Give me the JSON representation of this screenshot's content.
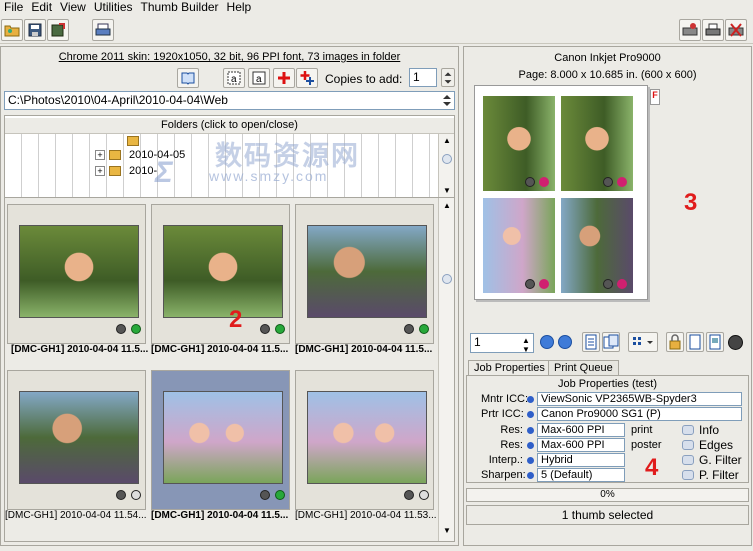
{
  "menu": [
    "File",
    "Edit",
    "View",
    "Utilities",
    "Thumb Builder",
    "Help"
  ],
  "left": {
    "info_line": "Chrome 2011 skin: 1920x1050, 32 bit, 96 PPI font, 73 images in folder",
    "copies_label": "Copies to add:",
    "copies_value": "1",
    "path": "C:\\Photos\\2010\\04-April\\2010-04-04\\Web",
    "folders_header": "Folders (click to open/close)",
    "folders": [
      "2010-04-05",
      "2010-"
    ],
    "thumbs": [
      {
        "caption": "[DMC-GH1] 2010-04-04 11.5...",
        "selected": false
      },
      {
        "caption": "[DMC-GH1] 2010-04-04 11.5...",
        "selected": false
      },
      {
        "caption": "[DMC-GH1] 2010-04-04 11.5...",
        "selected": false
      },
      {
        "caption": "[DMC-GH1] 2010-04-04 11.54...",
        "selected": false
      },
      {
        "caption": "[DMC-GH1] 2010-04-04 11.5...",
        "selected": true
      },
      {
        "caption": "[DMC-GH1] 2010-04-04 11.53...",
        "selected": false
      }
    ]
  },
  "right": {
    "printer": "Canon Inkjet Pro9000",
    "page_info": "Page: 8.000 x 10.685 in.  (600 x 600)",
    "page_flag": "F",
    "page_number": "1",
    "tabs": [
      "Job Properties",
      "Print Queue"
    ],
    "job_title": "Job Properties (test)",
    "mntr_label": "Mntr ICC:",
    "mntr_value": "ViewSonic VP2365WB-Spyder3",
    "prtr_label": "Prtr ICC:",
    "prtr_value": "Canon Pro9000 SG1 (P)",
    "res_label": "Res:",
    "res_print_value": "Max-600 PPI",
    "res_print_suffix": "print",
    "res_poster_value": "Max-600 PPI",
    "res_poster_suffix": "poster",
    "interp_label": "Interp.:",
    "interp_value": "Hybrid",
    "sharpen_label": "Sharpen:",
    "sharpen_value": "5 (Default)",
    "toggles": [
      "Info",
      "Edges",
      "G. Filter",
      "P. Filter"
    ],
    "progress": "0%",
    "status": "1 thumb selected"
  },
  "annotations": [
    "2",
    "3",
    "4"
  ],
  "watermark": {
    "cn": "数码资源网",
    "url": "www.smzy.com"
  }
}
